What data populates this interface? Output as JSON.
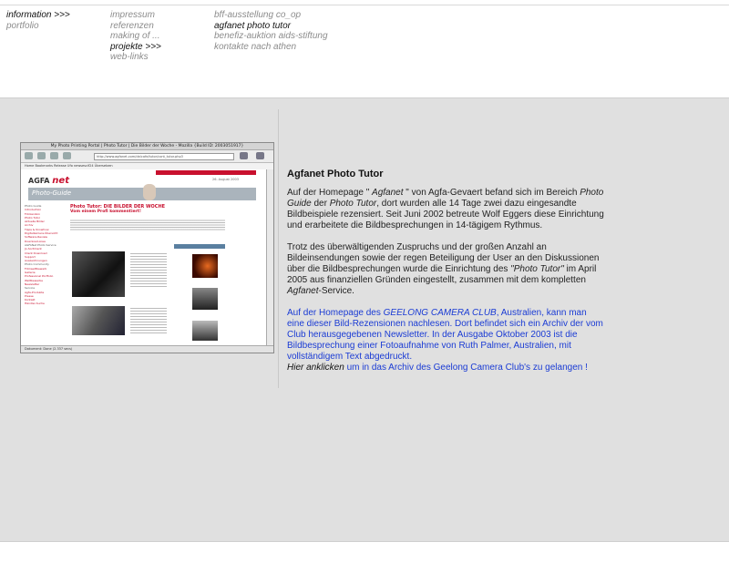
{
  "nav": {
    "col1": [
      {
        "label": "information >>>",
        "active": true
      },
      {
        "label": "portfolio",
        "active": false
      }
    ],
    "col2": [
      {
        "label": "impressum",
        "active": false
      },
      {
        "label": "referenzen",
        "active": false
      },
      {
        "label": "making of ...",
        "active": false
      },
      {
        "label": "projekte >>>",
        "active": true
      },
      {
        "label": "web-links",
        "active": false
      }
    ],
    "col3": [
      {
        "label": "bff-ausstellung co_op",
        "active": false
      },
      {
        "label": "agfanet photo tutor",
        "active": true
      },
      {
        "label": "benefiz-auktion aids-stiftung",
        "active": false
      },
      {
        "label": "kontakte nach athen",
        "active": false
      }
    ]
  },
  "thumbnail": {
    "window_title": "My Photo Printing Portal | Photo Tutor | Die Bilder der Woche - Mozilla {Build ID: 2003051917}",
    "url": "http://www.agfanet.com/de/cafe/tutor/cont_tutor.php3",
    "bookmarks": "Home  Bookmarks  Release  Ufo  newsescif24  Übersetzen",
    "logo_left": "AGFA",
    "logo_right": "net",
    "banner": "Photo-Guide",
    "date": "26. August 2003",
    "heading": "Photo Tutor: DIE BILDER DER WOCHE",
    "subheading": "Vom einem Profi kommentiert!",
    "menu": [
      "Photo Guide",
      "Introduction",
      "Fotolexikon",
      "Photo Tutor",
      "Aktuelle Bilder",
      "Archiv",
      "Tipps & Knowhow",
      "Digitalkamera-Übersicht",
      "Software-Review",
      "Download-Area",
      "AGFANet Photo Service",
      "Jo-Sortiment",
      "Client Download",
      "Support",
      "Auszeichnungen",
      "Photo Community",
      "Fotowettbewerb",
      "Gallerie",
      "Professional Portfolio",
      "Wettbewerbe",
      "Newsletter",
      "Service",
      "Agfa-Produkte",
      "Presse",
      "Kontakt",
      "Händler-Suche"
    ],
    "status": "Dokument: Done (2.337 secs)"
  },
  "article": {
    "title": "Agfanet Photo Tutor",
    "p1": {
      "t1": "Auf der Homepage \" ",
      "em1": "Agfanet",
      "t2": " \" von Agfa-Gevaert befand sich im Bereich ",
      "em2": "Photo Guide",
      "t3": " der ",
      "em3": "Photo Tutor",
      "t4": ", dort wurden alle 14 Tage zwei dazu eingesandte Bildbeispiele rezensiert. Seit Juni 2002 betreute Wolf Eggers diese Einrichtung und erarbeitete die Bildbesprechungen in 14-tägigem Rythmus."
    },
    "p2": {
      "t1": "Trotz des überwältigenden Zuspruchs und der großen Anzahl an Bildeinsendungen sowie der regen Beteiligung der User an den Diskussionen über die Bildbesprechungen wurde die Einrichtung des ",
      "em1": "\"Photo Tutor\"",
      "t2": " im April 2005 aus finanziellen Gründen eingestellt, zusammen mit dem kompletten ",
      "em2": "Agfanet",
      "t3": "-Service."
    },
    "p3": {
      "t1": "Auf der Homepage des ",
      "em1": "GEELONG CAMERA CLUB",
      "t2": ", Australien, kann man eine dieser Bild-Rezensionen nachlesen. Dort befindet sich ein Archiv der vom Club herausgegebenen Newsletter. In der Ausgabe Oktober 2003 ist die Bildbesprechung einer Fotoaufnahme von Ruth Palmer, Australien, mit vollständigem Text abgedruckt.",
      "link": "Hier anklicken",
      "t3": " um in das Archiv des Geelong Camera Club's zu gelangen !"
    }
  }
}
